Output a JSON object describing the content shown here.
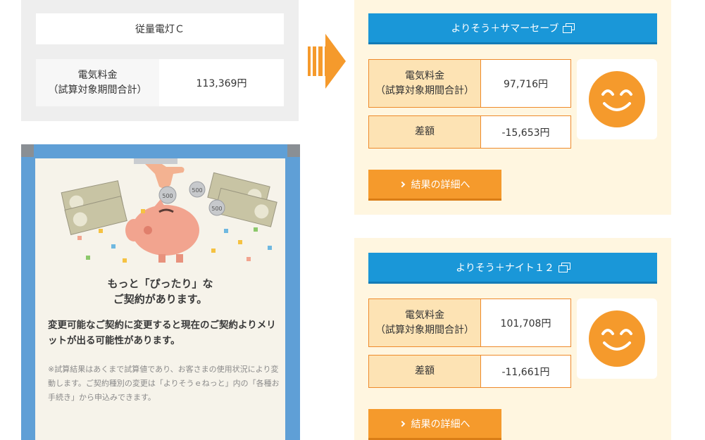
{
  "current_plan": {
    "name": "従量電灯Ｃ",
    "fee_label_1": "電気料金",
    "fee_label_2": "（試算対象期間合計）",
    "fee_value": "113,369円"
  },
  "promo": {
    "title_1": "もっと「ぴったり」な",
    "title_2": "ご契約があります。",
    "body": "変更可能なご契約に変更すると現在のご契約よりメリットが出る可能性があります。",
    "note": "※試算結果はあくまで試算値であり、お客さまの使用状況により変動します。ご契約種別の変更は「よりそうｅねっと」内の「各種お手続き」から申込みできます。",
    "coin_label": "500"
  },
  "plans": [
    {
      "name": "よりそう＋サマーセーブ",
      "fee_label_1": "電気料金",
      "fee_label_2": "（試算対象期間合計）",
      "fee_value": "97,716円",
      "diff_label": "差額",
      "diff_value": "-15,653円",
      "detail_label": "結果の詳細へ"
    },
    {
      "name": "よりそう＋ナイト１２",
      "fee_label_1": "電気料金",
      "fee_label_2": "（試算対象期間合計）",
      "fee_value": "101,708円",
      "diff_label": "差額",
      "diff_value": "-11,661円",
      "detail_label": "結果の詳細へ"
    }
  ],
  "colors": {
    "plan_button": "#1a97d8",
    "detail_button": "#f59a2c",
    "accent_orange": "#ee8a2b",
    "card_bg": "#fff6e0",
    "promo_frame": "#5f9fd6"
  },
  "icons": {
    "arrow": "right-arrow-icon",
    "new_window": "new-window-icon",
    "smiley": "smiley-face-icon",
    "chevron": "chevron-right-icon"
  }
}
